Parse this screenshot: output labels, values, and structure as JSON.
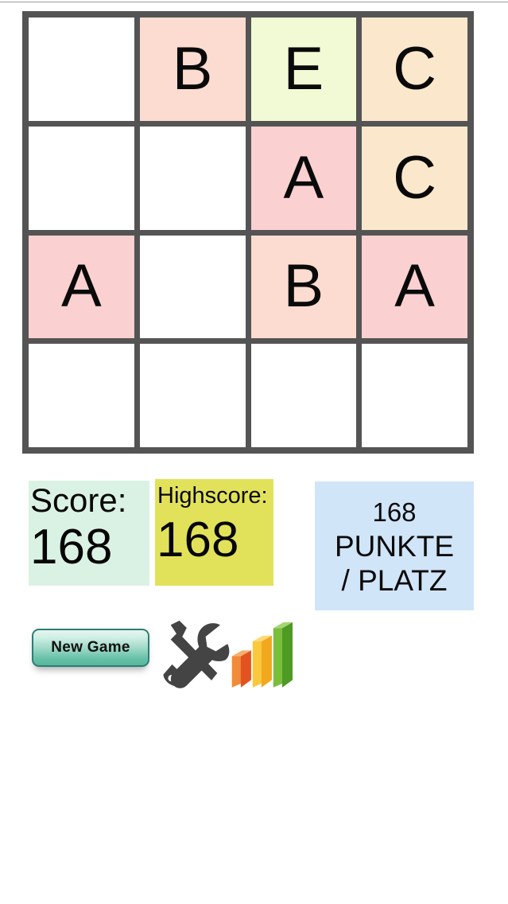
{
  "game": {
    "grid": {
      "rows": 4,
      "cols": 4,
      "border_color": "#545454",
      "cells": [
        {
          "letter": "",
          "color": "#ffffff"
        },
        {
          "letter": "B",
          "color": "#fcdcd0"
        },
        {
          "letter": "E",
          "color": "#f1fad4"
        },
        {
          "letter": "C",
          "color": "#fbe8cc"
        },
        {
          "letter": "",
          "color": "#ffffff"
        },
        {
          "letter": "",
          "color": "#ffffff"
        },
        {
          "letter": "A",
          "color": "#fbd0d0"
        },
        {
          "letter": "C",
          "color": "#fbe8cc"
        },
        {
          "letter": "A",
          "color": "#fbd0d0"
        },
        {
          "letter": "",
          "color": "#ffffff"
        },
        {
          "letter": "B",
          "color": "#fcdcd0"
        },
        {
          "letter": "A",
          "color": "#fbd0d0"
        },
        {
          "letter": "",
          "color": "#ffffff"
        },
        {
          "letter": "",
          "color": "#ffffff"
        },
        {
          "letter": "",
          "color": "#ffffff"
        },
        {
          "letter": "",
          "color": "#ffffff"
        }
      ]
    }
  },
  "score_panel": {
    "score": {
      "label": "Score:",
      "value": "168",
      "background": "#daf2e3"
    },
    "highscore": {
      "label": "Highscore:",
      "value": "168",
      "background": "#e2e25a"
    },
    "rank": {
      "line1": "168",
      "line2": "PUNKTE",
      "line3": "/ PLATZ",
      "background": "#d0e5f8"
    }
  },
  "actions": {
    "new_game": {
      "label": "New Game",
      "icon": "new-game-button"
    },
    "settings": {
      "icon": "tools-icon",
      "color": "#444444"
    },
    "statistics": {
      "icon": "bar-chart-icon",
      "bar_colors": [
        "#ef6c23",
        "#f7c228",
        "#56a game"
      ]
    }
  }
}
